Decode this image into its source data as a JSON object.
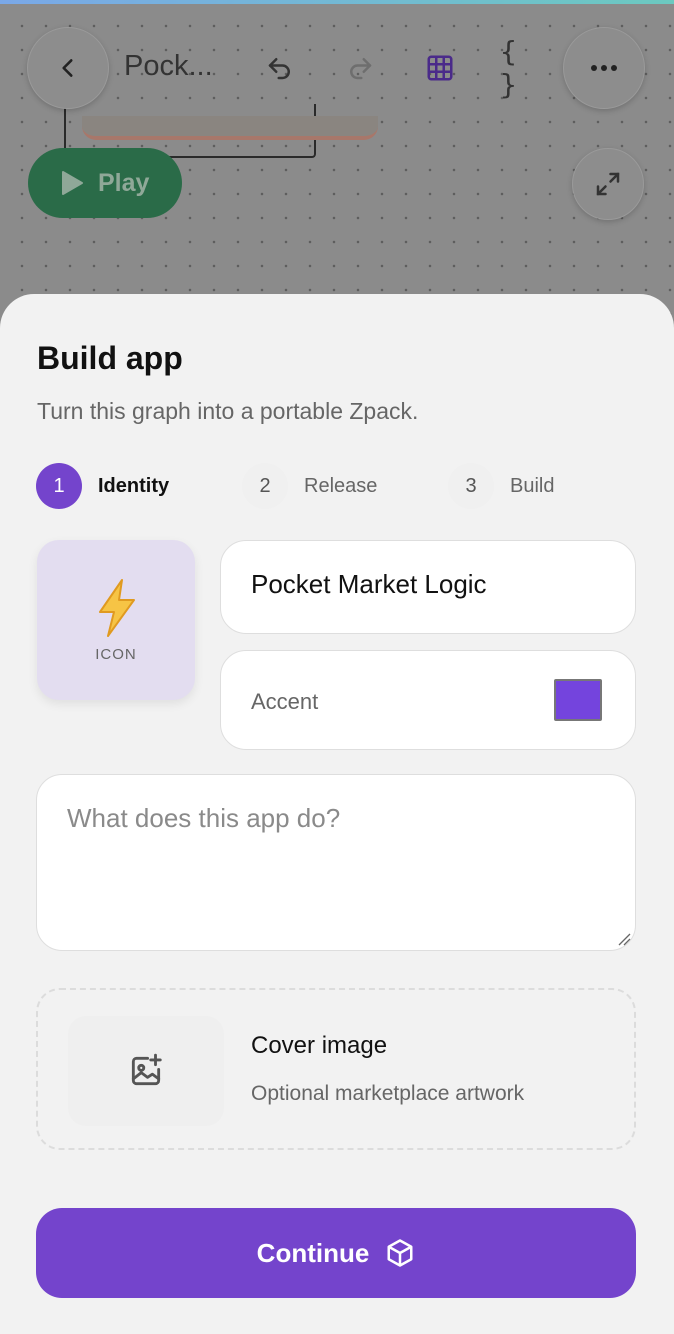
{
  "toolbar": {
    "title": "Pock...",
    "back_icon": "chevron-left-icon",
    "undo_icon": "undo-icon",
    "redo_icon": "redo-icon",
    "grid_icon": "grid-icon",
    "code_label": "{ }",
    "more_icon": "more-horizontal-icon"
  },
  "canvas": {
    "play_label": "Play",
    "expand_icon": "expand-icon"
  },
  "sheet": {
    "title": "Build app",
    "subtitle": "Turn this graph into a portable Zpack.",
    "steps": [
      {
        "number": "1",
        "label": "Identity",
        "active": true
      },
      {
        "number": "2",
        "label": "Release",
        "active": false
      },
      {
        "number": "3",
        "label": "Build",
        "active": false
      }
    ],
    "icon_tile": {
      "glyph": "⚡",
      "label": "ICON"
    },
    "name_value": "Pocket Market Logic",
    "accent_label": "Accent",
    "accent_color": "#7444dd",
    "description_placeholder": "What does this app do?",
    "cover": {
      "title": "Cover image",
      "subtitle": "Optional marketplace artwork",
      "icon": "image-plus-icon"
    },
    "continue_label": "Continue",
    "continue_icon": "cube-icon"
  },
  "colors": {
    "brand": "#7444cc",
    "play_green": "#2a6b48"
  }
}
